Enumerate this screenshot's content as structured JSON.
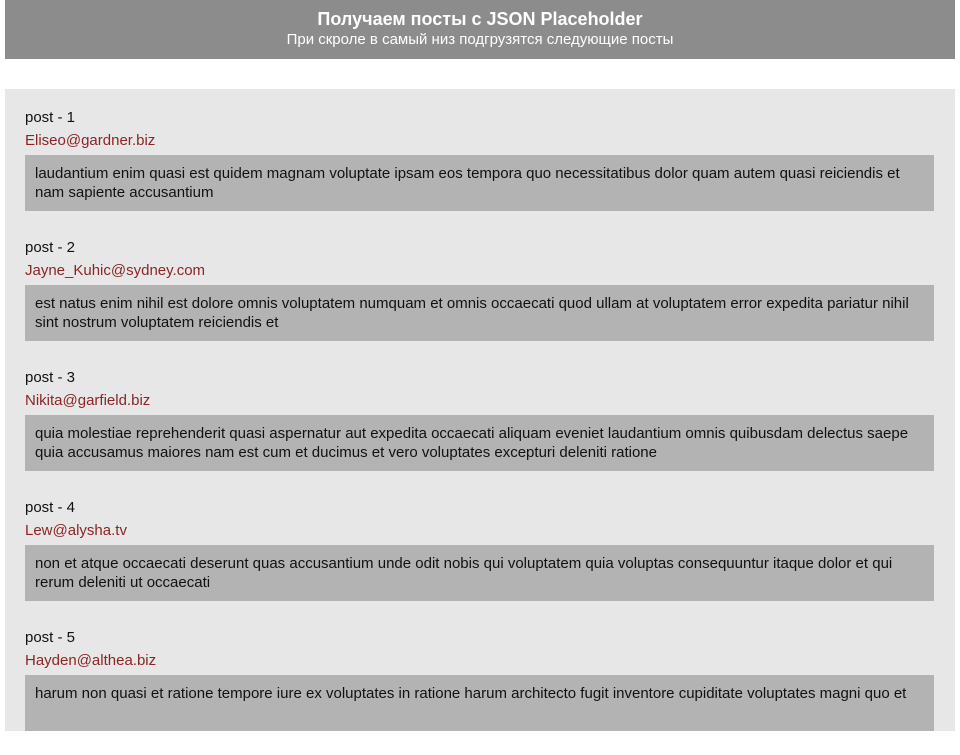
{
  "header": {
    "title": "Получаем посты с JSON Placeholder",
    "subtitle": "При скроле в самый низ подгрузятся следующие посты"
  },
  "posts": [
    {
      "label": "post - 1",
      "email": "Eliseo@gardner.biz",
      "body": "laudantium enim quasi est quidem magnam voluptate ipsam eos tempora quo necessitatibus dolor quam autem quasi reiciendis et nam sapiente accusantium"
    },
    {
      "label": "post - 2",
      "email": "Jayne_Kuhic@sydney.com",
      "body": "est natus enim nihil est dolore omnis voluptatem numquam et omnis occaecati quod ullam at voluptatem error expedita pariatur nihil sint nostrum voluptatem reiciendis et"
    },
    {
      "label": "post - 3",
      "email": "Nikita@garfield.biz",
      "body": "quia molestiae reprehenderit quasi aspernatur aut expedita occaecati aliquam eveniet laudantium omnis quibusdam delectus saepe quia accusamus maiores nam est cum et ducimus et vero voluptates excepturi deleniti ratione"
    },
    {
      "label": "post - 4",
      "email": "Lew@alysha.tv",
      "body": "non et atque occaecati deserunt quas accusantium unde odit nobis qui voluptatem quia voluptas consequuntur itaque dolor et qui rerum deleniti ut occaecati"
    },
    {
      "label": "post - 5",
      "email": "Hayden@althea.biz",
      "body": "harum non quasi et ratione tempore iure ex voluptates in ratione harum architecto fugit inventore cupiditate voluptates magni quo et"
    }
  ]
}
